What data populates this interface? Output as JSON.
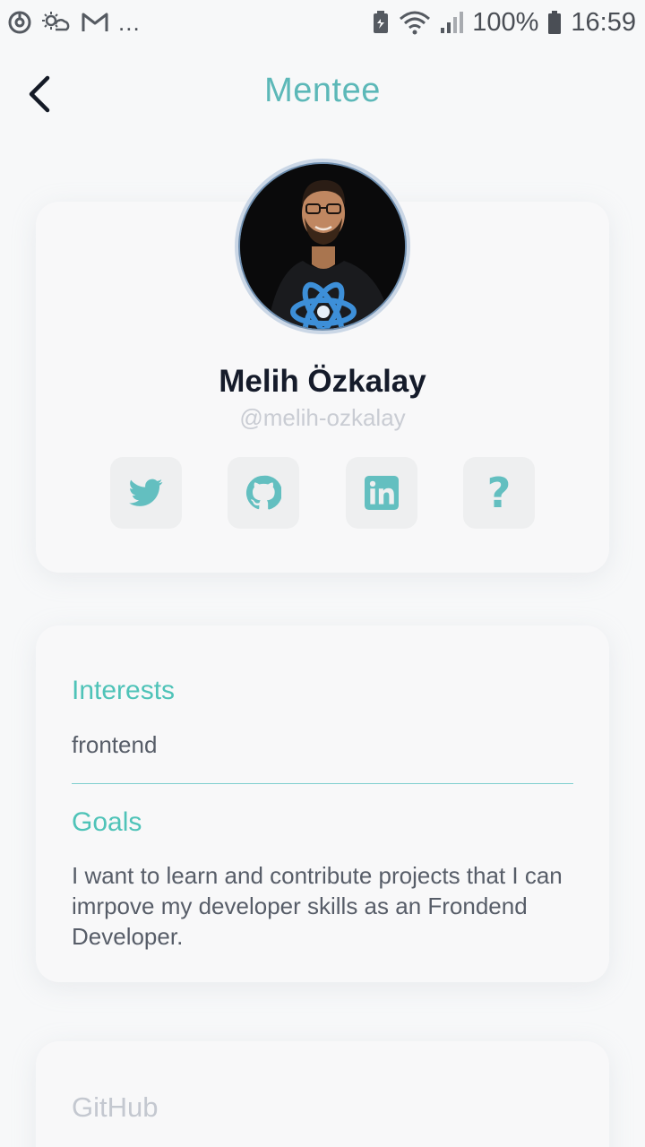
{
  "status_bar": {
    "battery_percent": "100%",
    "time": "16:59",
    "more": "...",
    "icons": [
      "sync-icon",
      "weather-icon",
      "gmail-icon",
      "battery-saver-icon",
      "wifi-icon",
      "signal-icon",
      "battery-icon"
    ]
  },
  "header": {
    "title": "Mentee",
    "back_icon": "chevron-left-icon"
  },
  "profile": {
    "name": "Melih Özkalay",
    "handle": "@melih-ozkalay",
    "social": [
      {
        "name": "twitter",
        "icon": "twitter-icon"
      },
      {
        "name": "github",
        "icon": "github-icon"
      },
      {
        "name": "linkedin",
        "icon": "linkedin-icon"
      },
      {
        "name": "other",
        "icon": "question-icon",
        "glyph": "?"
      }
    ]
  },
  "interests": {
    "label": "Interests",
    "value": "frontend"
  },
  "goals": {
    "label": "Goals",
    "value": "I want to learn and contribute projects that I can imrpove my developer skills as an Frondend Developer."
  },
  "github": {
    "label": "GitHub"
  },
  "colors": {
    "accent": "#5cb8b8",
    "label_green": "#4fc3b8",
    "social_icon": "#63bfc0",
    "background": "#f7f8f9"
  }
}
